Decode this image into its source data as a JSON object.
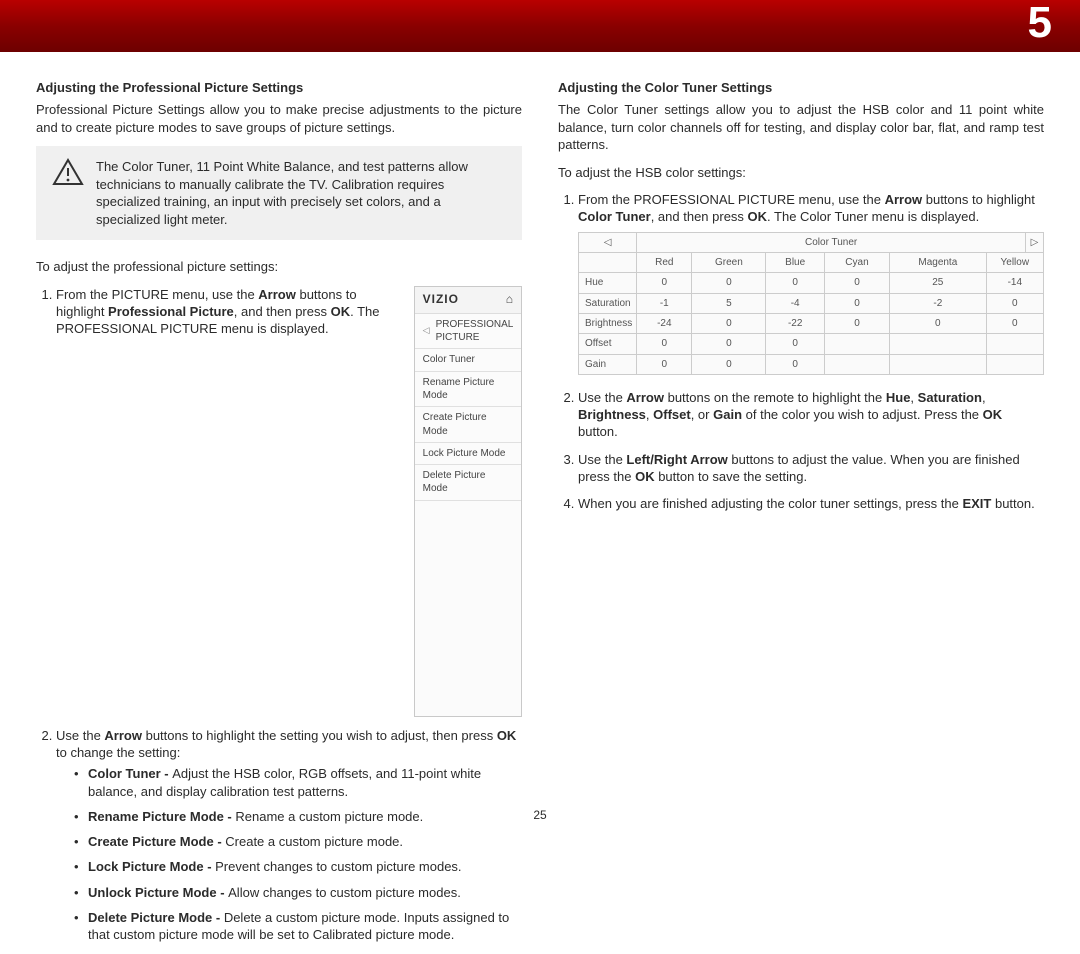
{
  "chapter_number": "5",
  "page_number": "25",
  "left": {
    "heading": "Adjusting the Professional Picture Settings",
    "intro": "Professional Picture Settings allow you to make precise adjustments to the picture and to create picture modes to save groups of picture settings.",
    "notice": "The Color Tuner, 11 Point White Balance, and test patterns allow technicians to manually calibrate the TV. Calibration requires specialized training, an input with precisely set colors, and a specialized light meter.",
    "to_adjust": "To adjust the professional picture settings:",
    "steps": {
      "s1_a": "From the PICTURE menu, use the ",
      "s1_b": "Arrow",
      "s1_c": " buttons to highlight ",
      "s1_d": "Professional Picture",
      "s1_e": ", and then press ",
      "s1_f": "OK",
      "s1_g": ". The PROFESSIONAL PICTURE menu is displayed.",
      "s2_a": "Use the ",
      "s2_b": "Arrow",
      "s2_c": " buttons to highlight the setting you wish to adjust, then press ",
      "s2_d": "OK",
      "s2_e": " to change the setting:"
    },
    "bullets": {
      "b1_t": "Color Tuner - ",
      "b1_r": "Adjust the HSB color, RGB offsets, and 11-point white balance, and display calibration test patterns.",
      "b2_t": "Rename Picture Mode - ",
      "b2_r": "Rename a custom picture mode.",
      "b3_t": "Create Picture Mode - ",
      "b3_r": "Create a custom picture mode.",
      "b4_t": "Lock Picture Mode - ",
      "b4_r": "Prevent changes to custom picture modes.",
      "b5_t": "Unlock Picture Mode - ",
      "b5_r": "Allow changes to custom picture modes.",
      "b6_t": "Delete Picture Mode - ",
      "b6_r": "Delete a custom picture mode. Inputs assigned to that custom picture mode will be set to Calibrated picture mode."
    },
    "menu": {
      "logo": "VIZIO",
      "home_icon": "⌂",
      "title": "PROFESSIONAL PICTURE",
      "items": [
        "Color Tuner",
        "Rename Picture Mode",
        "Create Picture Mode",
        "Lock Picture Mode",
        "Delete Picture Mode"
      ]
    }
  },
  "right": {
    "heading": "Adjusting the Color Tuner Settings",
    "intro": "The Color Tuner settings allow you to adjust the HSB color and 11 point white balance, turn color channels off for testing, and display color bar, flat, and ramp test patterns.",
    "to_adjust": "To adjust the HSB color settings:",
    "steps": {
      "s1_a": "From the PROFESSIONAL PICTURE menu, use the ",
      "s1_b": "Arrow",
      "s1_c": " buttons to highlight ",
      "s1_d": "Color Tuner",
      "s1_e": ", and then press ",
      "s1_f": "OK",
      "s1_g": ". The Color Tuner menu is displayed.",
      "s2_a": "Use the ",
      "s2_b": "Arrow",
      "s2_c": " buttons on the remote to highlight the ",
      "s2_d": "Hue",
      "s2_e": ", ",
      "s2_f": "Saturation",
      "s2_g": ", ",
      "s2_h": "Brightness",
      "s2_i": ", ",
      "s2_j": "Offset",
      "s2_k": ", or ",
      "s2_l": "Gain",
      "s2_m": " of the color you wish to adjust. Press the ",
      "s2_n": "OK",
      "s2_o": "  button.",
      "s3_a": "Use the ",
      "s3_b": "Left/Right Arrow",
      "s3_c": " buttons to adjust the value. When you are finished press the ",
      "s3_d": "OK",
      "s3_e": " button to save the setting.",
      "s4_a": "When you are finished adjusting the color tuner settings, press the ",
      "s4_b": "EXIT",
      "s4_c": " button."
    },
    "ct": {
      "title": "Color Tuner",
      "left_arrow": "◁",
      "right_arrow": "▷",
      "cols": [
        "Red",
        "Green",
        "Blue",
        "Cyan",
        "Magenta",
        "Yellow"
      ],
      "rows": [
        {
          "label": "Hue",
          "v": [
            "0",
            "0",
            "0",
            "0",
            "25",
            "-14"
          ]
        },
        {
          "label": "Saturation",
          "v": [
            "-1",
            "5",
            "-4",
            "0",
            "-2",
            "0"
          ]
        },
        {
          "label": "Brightness",
          "v": [
            "-24",
            "0",
            "-22",
            "0",
            "0",
            "0"
          ]
        },
        {
          "label": "Offset",
          "v": [
            "0",
            "0",
            "0",
            "",
            "",
            ""
          ]
        },
        {
          "label": "Gain",
          "v": [
            "0",
            "0",
            "0",
            "",
            "",
            ""
          ]
        }
      ]
    }
  }
}
